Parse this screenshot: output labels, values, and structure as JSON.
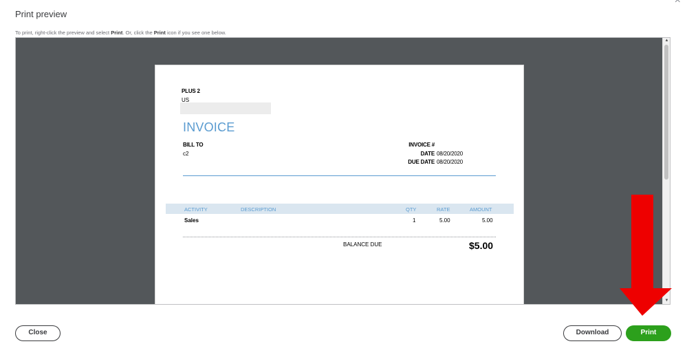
{
  "dialog": {
    "title": "Print preview",
    "close_glyph": "×",
    "instructions": {
      "part1": "To print, right-click the preview and select ",
      "bold1": "Print",
      "part2": ". Or, click the ",
      "bold2": "Print",
      "part3": " icon if you see one below."
    }
  },
  "invoice": {
    "company_name": "PLUS 2",
    "company_country": "US",
    "heading": "INVOICE",
    "bill_to_label": "BILL TO",
    "bill_to_value": "c2",
    "invoice_no_label": "INVOICE #",
    "date_label": "DATE",
    "date_value": "08/20/2020",
    "due_date_label": "DUE DATE",
    "due_date_value": "08/20/2020",
    "columns": {
      "activity": "ACTIVITY",
      "description": "DESCRIPTION",
      "qty": "QTY",
      "rate": "RATE",
      "amount": "AMOUNT"
    },
    "line_items": [
      {
        "activity": "Sales",
        "description": "",
        "qty": "1",
        "rate": "5.00",
        "amount": "5.00"
      }
    ],
    "balance_due_label": "BALANCE DUE",
    "balance_due_value": "$5.00"
  },
  "buttons": {
    "close": "Close",
    "download": "Download",
    "print": "Print"
  },
  "colors": {
    "accent_blue": "#5a9bd0",
    "print_green": "#2ca01c",
    "annotation_red": "#ee0000",
    "preview_bg": "#53575a"
  },
  "icons": {
    "close": "close-icon",
    "scroll_up": "scroll-up-arrow-icon",
    "scroll_down": "scroll-down-arrow-icon",
    "annotation": "red-down-arrow-icon"
  }
}
